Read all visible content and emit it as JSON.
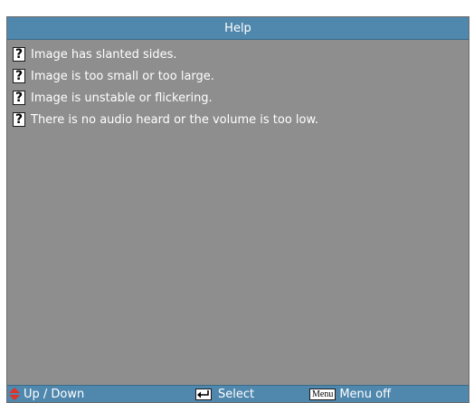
{
  "title": "Help",
  "items": [
    {
      "icon": "question-icon",
      "label": "Image has slanted sides."
    },
    {
      "icon": "question-icon",
      "label": "Image is too small or too large."
    },
    {
      "icon": "question-icon",
      "label": "Image is unstable or flickering."
    },
    {
      "icon": "question-icon",
      "label": "There is no audio heard or the volume is too low."
    }
  ],
  "icon_glyph": "?",
  "footer": {
    "updown_label": "Up / Down",
    "select_label": "Select",
    "menu_key": "Menu",
    "menu_label": "Menu off"
  },
  "colors": {
    "title_bar": "#4f87ad",
    "panel": "#8e8e8e",
    "updown_arrow": "#e0332a"
  }
}
